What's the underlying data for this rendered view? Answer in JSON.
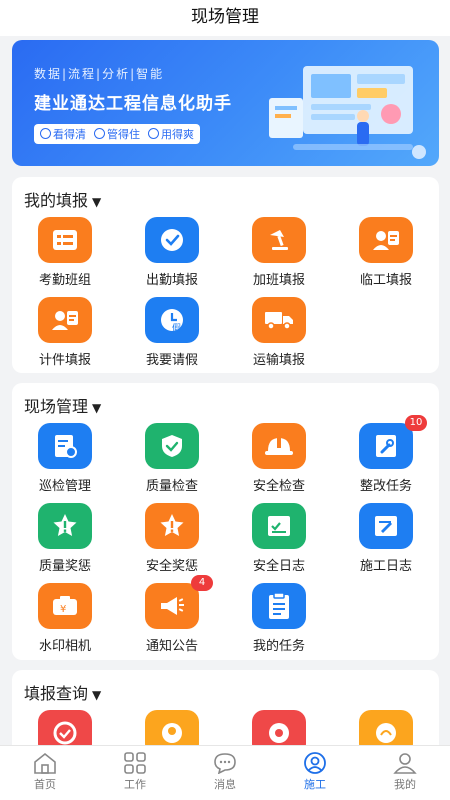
{
  "header": {
    "title": "现场管理"
  },
  "banner": {
    "subtitle": "数据|流程|分析|智能",
    "title": "建业通达工程信息化助手",
    "tags": [
      "看得清",
      "管得住",
      "用得爽"
    ]
  },
  "sections": {
    "my_report": {
      "title": "我的填报",
      "items": [
        "考勤班组",
        "出勤填报",
        "加班填报",
        "临工填报",
        "计件填报",
        "我要请假",
        "运输填报"
      ]
    },
    "site_management": {
      "title": "现场管理",
      "items": [
        "巡检管理",
        "质量检查",
        "安全检查",
        "整改任务",
        "质量奖惩",
        "安全奖惩",
        "安全日志",
        "施工日志",
        "水印相机",
        "通知公告",
        "我的任务"
      ],
      "badges": {
        "rectify": "10",
        "notice": "4"
      }
    },
    "report_query": {
      "title": "填报查询"
    }
  },
  "tabbar": {
    "items": [
      "首页",
      "工作",
      "消息",
      "施工",
      "我的"
    ],
    "active": "施工"
  },
  "colors": {
    "primary": "#1e7ef2",
    "orange": "#fa7d1e",
    "green": "#1fb36e",
    "red": "#ef4848",
    "badge": "#ee3b3b"
  }
}
